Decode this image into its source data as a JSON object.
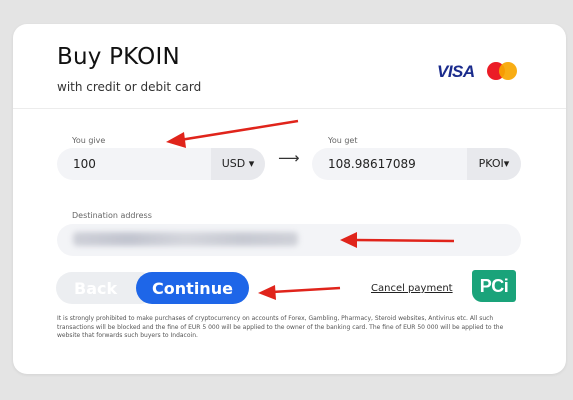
{
  "header": {
    "title": "Buy PKOIN",
    "subtitle": "with credit or debit card",
    "card_brands": {
      "visa_label": "VISA",
      "mastercard_icon": "mastercard-icon"
    }
  },
  "exchange": {
    "give_label": "You give",
    "give_value": "100",
    "give_currency": "USD ▾",
    "arrow_glyph": "⟶",
    "get_label": "You get",
    "get_value": "108.98617089",
    "get_currency": "PKOI▾"
  },
  "destination": {
    "label": "Destination address",
    "value_state": "blurred"
  },
  "actions": {
    "back_label": "Back",
    "continue_label": "Continue",
    "cancel_label": "Cancel payment",
    "pci_label": "PCi"
  },
  "disclaimer": "It is strongly prohibited to make purchases of cryptocurrency on accounts of Forex, Gambling, Pharmacy, Steroid websites, Antivirus etc. All such transactions will be blocked and the fine of EUR 5 000 will be applied to the owner of the banking card. The fine of EUR 50 000 will be applied to the website that forwards such buyers to Indacoin.",
  "colors": {
    "accent": "#1e66e8",
    "annotation_arrow": "#e0241b",
    "pci_green": "#1aa37a"
  }
}
